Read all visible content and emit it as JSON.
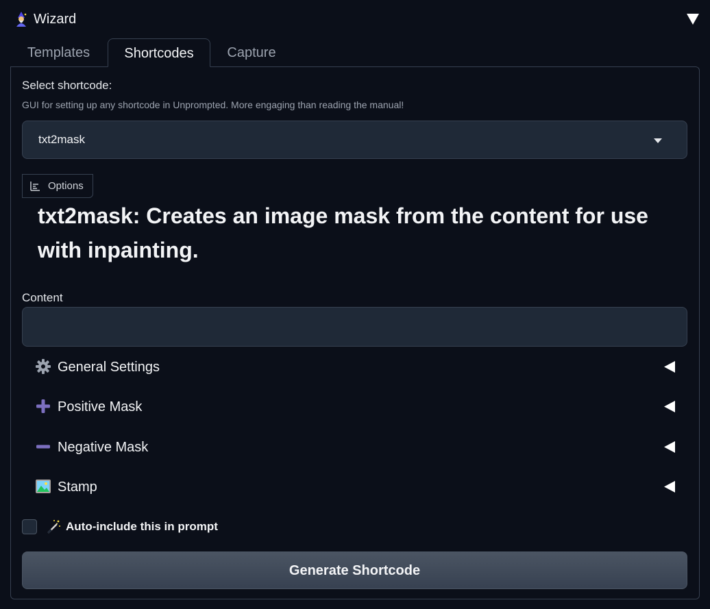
{
  "header": {
    "title": "Wizard",
    "icon": "wizard-icon",
    "toggle_icon": "triangle-down-icon"
  },
  "tabs": [
    {
      "label": "Templates",
      "active": false
    },
    {
      "label": "Shortcodes",
      "active": true
    },
    {
      "label": "Capture",
      "active": false
    }
  ],
  "shortcode_select": {
    "label": "Select shortcode:",
    "info": "GUI for setting up any shortcode in Unprompted. More engaging than reading the manual!",
    "value": "txt2mask",
    "caret_icon": "caret-down-icon"
  },
  "options_tag": {
    "label": "Options",
    "icon": "chart-icon"
  },
  "description": "txt2mask: Creates an image mask from the content for use with inpainting.",
  "content_field": {
    "label": "Content",
    "value": "",
    "placeholder": ""
  },
  "accordions": [
    {
      "label": "General Settings",
      "icon": "gear-icon"
    },
    {
      "label": "Positive Mask",
      "icon": "plus-icon"
    },
    {
      "label": "Negative Mask",
      "icon": "minus-icon"
    },
    {
      "label": "Stamp",
      "icon": "picture-icon"
    }
  ],
  "auto_include": {
    "label": "Auto-include this in prompt",
    "checked": false,
    "icon": "magic-wand-icon"
  },
  "generate_button": {
    "label": "Generate Shortcode"
  },
  "colors": {
    "background": "#0b0f19",
    "input_bg": "#1f2937",
    "border": "#374151",
    "button_bg": "#4b5563",
    "accent_purple": "#7c6fbf"
  }
}
